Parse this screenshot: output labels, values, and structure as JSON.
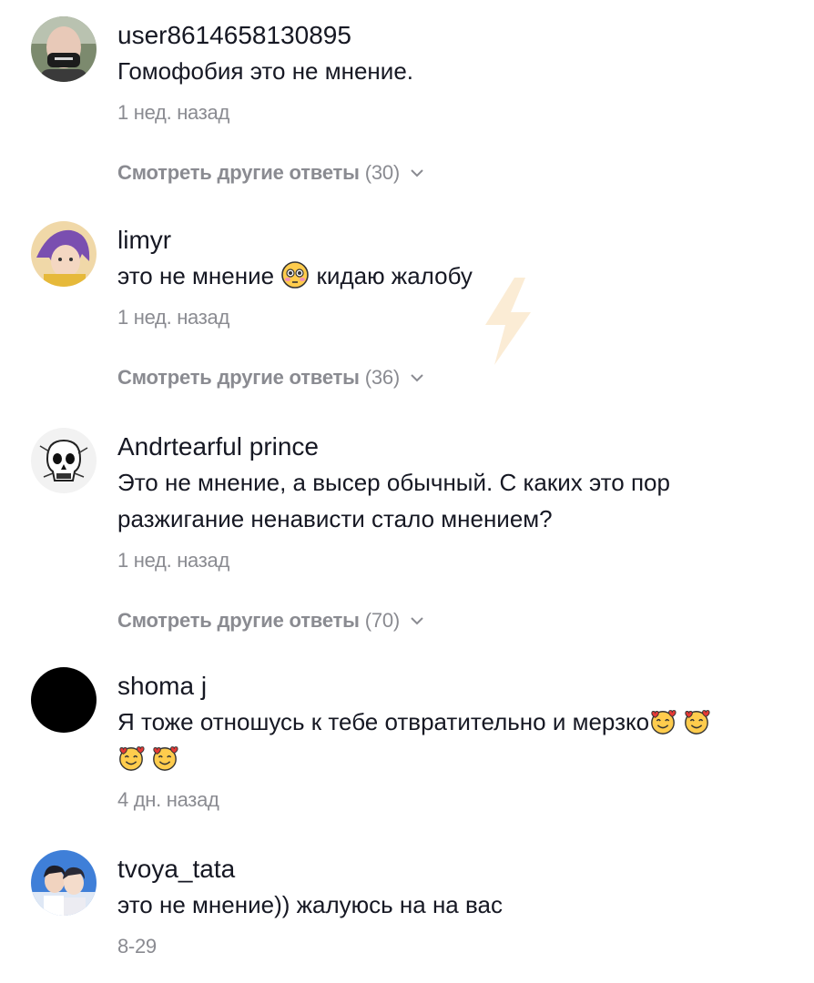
{
  "comments": [
    {
      "username": "user8614658130895",
      "text": "Гомофобия это не мнение.",
      "time": "1 нед. назад",
      "more_label": "Смотреть другие ответы",
      "more_count": "(30)",
      "avatar_icon": "person-in-mask-avatar"
    },
    {
      "username": "limyr",
      "text_before": "это не мнение",
      "text_after": "кидаю жалобу",
      "emoji": "flushed-face",
      "time": "1 нед. назад",
      "more_label": "Смотреть другие ответы",
      "more_count": "(36)",
      "avatar_icon": "anime-character-avatar"
    },
    {
      "username": "Andrtearful prince",
      "text_line1_a": "Это не мнение, а вы",
      "text_line1_b": "се",
      "text_line1_c": "р обычный. С каких это пор",
      "text_line2": "разжигание ненависти стало мнением?",
      "time": "1 нед. назад",
      "more_label": "Смотреть другие ответы",
      "more_count": "(70)",
      "avatar_icon": "skull-sketch-avatar"
    },
    {
      "username": "shoma j",
      "text": "Я тоже отношусь к тебе отвратительно и мерзко",
      "emoji": "smiling-face-with-hearts",
      "time": "4 дн. назад",
      "avatar_icon": "black-circle-avatar"
    },
    {
      "username": "tvoya_tata",
      "text": "это не мнение)) жалуюсь на на вас",
      "time": "8-29",
      "avatar_icon": "two-people-photo-avatar"
    }
  ],
  "colors": {
    "text": "#161823",
    "muted": "#8a8b91",
    "watermark": "#f5c98a"
  }
}
